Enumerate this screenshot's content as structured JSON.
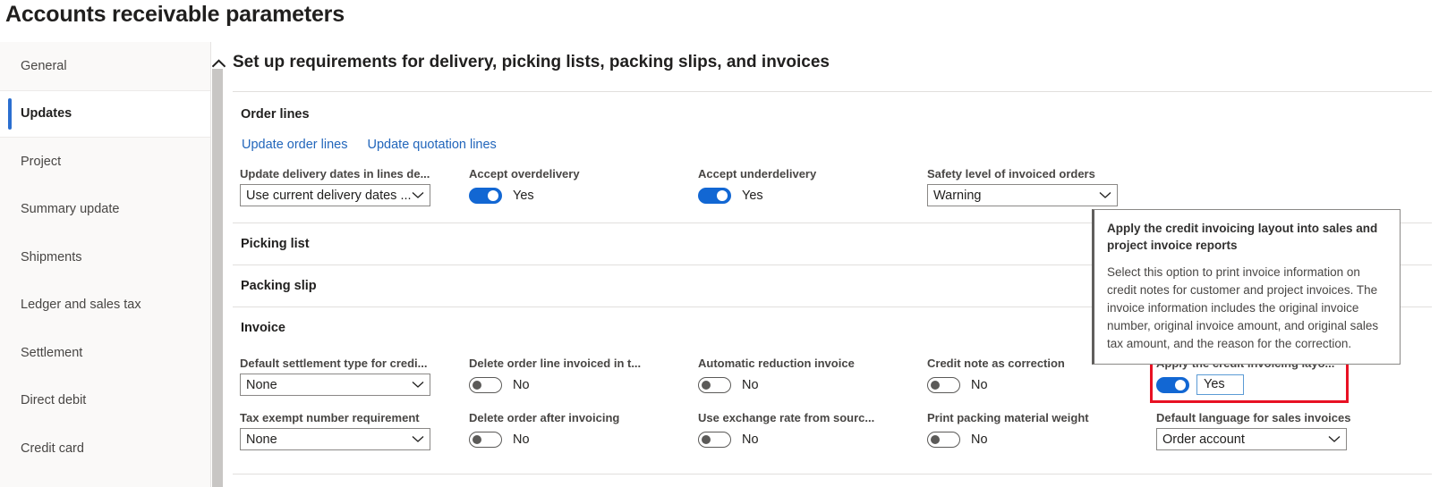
{
  "page": {
    "title": "Accounts receivable parameters"
  },
  "sidebar": {
    "items": [
      {
        "label": "General",
        "selected": false
      },
      {
        "label": "Updates",
        "selected": true
      },
      {
        "label": "Project",
        "selected": false
      },
      {
        "label": "Summary update",
        "selected": false
      },
      {
        "label": "Shipments",
        "selected": false
      },
      {
        "label": "Ledger and sales tax",
        "selected": false
      },
      {
        "label": "Settlement",
        "selected": false
      },
      {
        "label": "Direct debit",
        "selected": false
      },
      {
        "label": "Credit card",
        "selected": false
      }
    ]
  },
  "main": {
    "section_title": "Set up requirements for delivery, picking lists, packing slips, and invoices",
    "groups": {
      "order_lines": "Order lines",
      "picking_list": "Picking list",
      "packing_slip": "Packing slip",
      "invoice": "Invoice"
    },
    "links": {
      "update_order_lines": "Update order lines",
      "update_quotation_lines": "Update quotation lines"
    },
    "fields": {
      "update_delivery_dates": {
        "label": "Update delivery dates in lines de...",
        "value": "Use current delivery dates ..."
      },
      "accept_overdelivery": {
        "label": "Accept overdelivery",
        "value": "Yes",
        "state": "on"
      },
      "accept_underdelivery": {
        "label": "Accept underdelivery",
        "value": "Yes",
        "state": "on"
      },
      "safety_level": {
        "label": "Safety level of invoiced orders",
        "value": "Warning"
      },
      "default_settlement_type": {
        "label": "Default settlement type for credi...",
        "value": "None"
      },
      "delete_order_line_invoiced": {
        "label": "Delete order line invoiced in t...",
        "value": "No",
        "state": "off"
      },
      "automatic_reduction_invoice": {
        "label": "Automatic reduction invoice",
        "value": "No",
        "state": "off"
      },
      "credit_note_as_correction": {
        "label": "Credit note as correction",
        "value": "No",
        "state": "off"
      },
      "apply_credit_invoicing_layout": {
        "label": "Apply the credit invoicing layo...",
        "value": "Yes",
        "state": "on"
      },
      "tax_exempt_number_requirement": {
        "label": "Tax exempt number requirement",
        "value": "None"
      },
      "delete_order_after_invoicing": {
        "label": "Delete order after invoicing",
        "value": "No",
        "state": "off"
      },
      "use_exchange_rate_from_source": {
        "label": "Use exchange rate from sourc...",
        "value": "No",
        "state": "off"
      },
      "print_packing_material_weight": {
        "label": "Print packing material weight",
        "value": "No",
        "state": "off"
      },
      "default_language_sales_invoices": {
        "label": "Default language for sales invoices",
        "value": "Order account"
      }
    }
  },
  "tooltip": {
    "title": "Apply the credit invoicing layout into sales and project invoice reports",
    "body": "Select this option to print invoice information on credit notes for customer and project invoices. The invoice information includes the original invoice number, original invoice amount, and original sales tax amount, and the reason for the correction."
  },
  "colors": {
    "accent": "#1267d3",
    "link": "#2266bb",
    "highlight": "#e81123",
    "selected_bar": "#2b6fd0"
  }
}
